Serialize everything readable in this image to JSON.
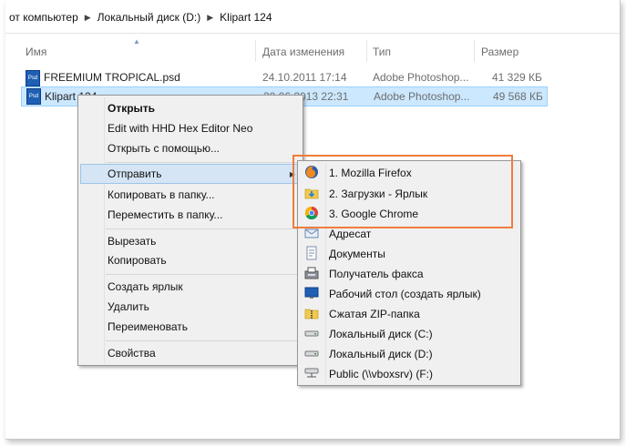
{
  "breadcrumb": [
    "от компьютер",
    "Локальный диск (D:)",
    "Klipart 124"
  ],
  "columns": {
    "name": "Имя",
    "date": "Дата изменения",
    "type": "Тип",
    "size": "Размер"
  },
  "files": [
    {
      "name": "FREEMIUM TROPICAL.psd",
      "date": "24.10.2011 17:14",
      "type": "Adobe Photoshop...",
      "size": "41 329 КБ",
      "icon": "psd-file-icon"
    },
    {
      "name": "Klipart 124",
      "date": "30.06.2013 22:31",
      "type": "Adobe Photoshop...",
      "size": "49 568 КБ",
      "icon": "psd-file-icon"
    }
  ],
  "file_icon_label": "Psd",
  "context_menu": {
    "open": "Открыть",
    "hex_editor": "Edit with HHD Hex Editor Neo",
    "open_with": "Открыть с помощью...",
    "send_to": "Отправить",
    "copy_to": "Копировать в папку...",
    "move_to": "Переместить в папку...",
    "cut": "Вырезать",
    "copy": "Копировать",
    "create_shortcut": "Создать ярлык",
    "delete": "Удалить",
    "rename": "Переименовать",
    "properties": "Свойства"
  },
  "send_to_menu": [
    {
      "label": "1. Mozilla Firefox",
      "icon": "firefox-icon"
    },
    {
      "label": "2. Загрузки - Ярлык",
      "icon": "downloads-folder-icon"
    },
    {
      "label": "3. Google Chrome",
      "icon": "chrome-icon"
    },
    {
      "label": "Адресат",
      "icon": "mail-recipient-icon"
    },
    {
      "label": "Документы",
      "icon": "documents-icon"
    },
    {
      "label": "Получатель факса",
      "icon": "fax-icon"
    },
    {
      "label": "Рабочий стол (создать ярлык)",
      "icon": "desktop-icon"
    },
    {
      "label": "Сжатая ZIP-папка",
      "icon": "zip-folder-icon"
    },
    {
      "label": "Локальный диск (C:)",
      "icon": "drive-icon"
    },
    {
      "label": "Локальный диск (D:)",
      "icon": "drive-icon"
    },
    {
      "label": "Public (\\\\vboxsrv) (F:)",
      "icon": "network-drive-icon"
    }
  ],
  "colors": {
    "highlight_callout": "#f07c3c",
    "selection": "#cce8ff",
    "menu_bg": "#f0f0f0"
  }
}
